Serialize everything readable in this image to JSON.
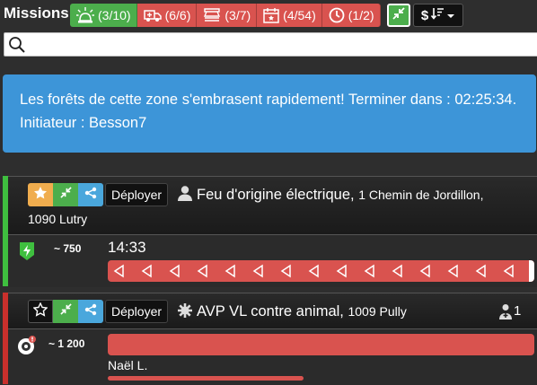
{
  "header": {
    "title": "Missions",
    "filters": [
      {
        "icon": "siren-icon",
        "label": "(3/10)",
        "color": "#4cae4c"
      },
      {
        "icon": "ambulance-icon",
        "label": "(6/6)",
        "color": "#d9534f"
      },
      {
        "icon": "police-icon",
        "label": "(3/7)",
        "color": "#d9534f"
      },
      {
        "icon": "calendar-icon",
        "label": "(4/54)",
        "color": "#d9534f"
      },
      {
        "icon": "clock-icon",
        "label": "(1/2)",
        "color": "#d9534f"
      }
    ],
    "collapse_icon": "compress-icon",
    "sort_label": "$"
  },
  "search": {
    "placeholder": "",
    "value": ""
  },
  "alert": {
    "text": "Les forêts de cette zone s'embrasent rapidement! Terminer dans : 02:25:34. Initiateur : Besson7"
  },
  "missions": [
    {
      "deploy_label": "Déployer",
      "title": "Feu d'origine électrique,",
      "address_line1": "1 Chemin de Jordillon,",
      "address_line2": "1090 Lutry",
      "credits": "~ 750",
      "timer": "14:33",
      "progress": 1.0,
      "starred": true,
      "border_color": "#3fbf3f"
    },
    {
      "deploy_label": "Déployer",
      "title": "AVP VL contre animal,",
      "address": "1009 Pully",
      "patients": "1",
      "credits": "~ 1 200",
      "person": "Naël L.",
      "starred": false,
      "border_color": "#c9302c"
    }
  ]
}
